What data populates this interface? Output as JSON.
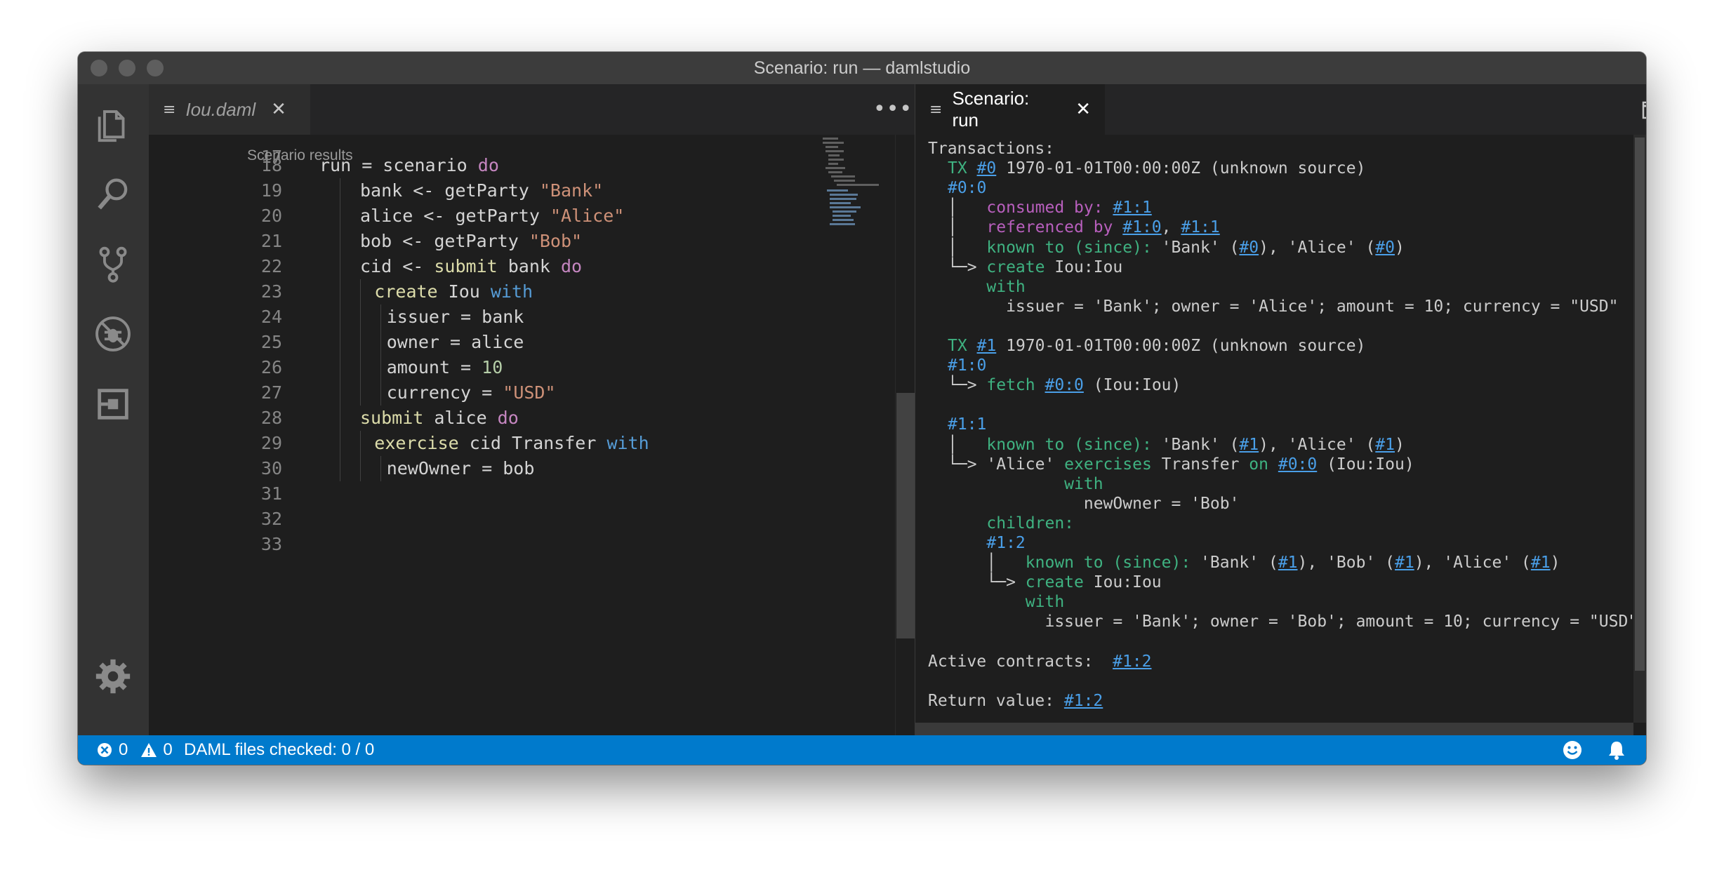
{
  "window": {
    "title": "Scenario: run — damlstudio"
  },
  "left_editor": {
    "tab_label": "Iou.daml",
    "codelens": "Scenario results",
    "partial_line_number": "17",
    "lines": [
      {
        "n": "18",
        "tokens": [
          [
            "run = scenario ",
            "p"
          ],
          [
            "do",
            "kw"
          ]
        ],
        "indent": 0
      },
      {
        "n": "19",
        "tokens": [
          [
            "bank <- getParty ",
            "p"
          ],
          [
            "\"Bank\"",
            "str"
          ]
        ],
        "indent": 1
      },
      {
        "n": "20",
        "tokens": [
          [
            "alice <- getParty ",
            "p"
          ],
          [
            "\"Alice\"",
            "str"
          ]
        ],
        "indent": 1
      },
      {
        "n": "21",
        "tokens": [
          [
            "bob <- getParty ",
            "p"
          ],
          [
            "\"Bob\"",
            "str"
          ]
        ],
        "indent": 1
      },
      {
        "n": "22",
        "tokens": [
          [
            "cid <- ",
            "p"
          ],
          [
            "submit",
            "fn"
          ],
          [
            " bank ",
            "p"
          ],
          [
            "do",
            "kw"
          ]
        ],
        "indent": 1
      },
      {
        "n": "23",
        "tokens": [
          [
            "create",
            "fn"
          ],
          [
            " Iou ",
            "p"
          ],
          [
            "with",
            "blue"
          ]
        ],
        "indent": 2
      },
      {
        "n": "24",
        "tokens": [
          [
            "issuer = bank",
            "p"
          ]
        ],
        "indent": 3
      },
      {
        "n": "25",
        "tokens": [
          [
            "owner = alice",
            "p"
          ]
        ],
        "indent": 3
      },
      {
        "n": "26",
        "tokens": [
          [
            "amount = ",
            "p"
          ],
          [
            "10",
            "num"
          ]
        ],
        "indent": 3
      },
      {
        "n": "27",
        "tokens": [
          [
            "currency = ",
            "p"
          ],
          [
            "\"USD\"",
            "str"
          ]
        ],
        "indent": 3
      },
      {
        "n": "28",
        "tokens": [
          [
            "submit",
            "fn"
          ],
          [
            " alice ",
            "p"
          ],
          [
            "do",
            "kw"
          ]
        ],
        "indent": 1
      },
      {
        "n": "29",
        "tokens": [
          [
            "exercise",
            "fn"
          ],
          [
            " cid Transfer ",
            "p"
          ],
          [
            "with",
            "blue"
          ]
        ],
        "indent": 2
      },
      {
        "n": "30",
        "tokens": [
          [
            "newOwner = bob",
            "p"
          ]
        ],
        "indent": 3
      },
      {
        "n": "31",
        "tokens": [],
        "indent": 0
      },
      {
        "n": "32",
        "tokens": [],
        "indent": 0
      },
      {
        "n": "33",
        "tokens": [],
        "indent": 0
      }
    ]
  },
  "right_editor": {
    "tab_label": "Scenario: run",
    "results": [
      {
        "x": 0,
        "tokens": [
          [
            "Transactions:",
            "p"
          ]
        ]
      },
      {
        "x": 2,
        "tokens": [
          [
            "TX ",
            "g"
          ],
          [
            "#0",
            "lnk"
          ],
          [
            " 1970-01-01T00:00:00Z (unknown source)",
            "p"
          ]
        ]
      },
      {
        "x": 2,
        "tokens": [
          [
            "#0:0",
            "b"
          ]
        ]
      },
      {
        "x": 2,
        "tokens": [
          [
            "│   ",
            "p"
          ],
          [
            "consumed by: ",
            "pp"
          ],
          [
            "#1:1",
            "lnk"
          ]
        ]
      },
      {
        "x": 2,
        "tokens": [
          [
            "│   ",
            "p"
          ],
          [
            "referenced by ",
            "pp"
          ],
          [
            "#1:0",
            "lnk"
          ],
          [
            ", ",
            "p"
          ],
          [
            "#1:1",
            "lnk"
          ]
        ]
      },
      {
        "x": 2,
        "tokens": [
          [
            "│   ",
            "p"
          ],
          [
            "known to (since): ",
            "g"
          ],
          [
            "'Bank' (",
            "p"
          ],
          [
            "#0",
            "lnk"
          ],
          [
            "), 'Alice' (",
            "p"
          ],
          [
            "#0",
            "lnk"
          ],
          [
            ")",
            "p"
          ]
        ]
      },
      {
        "x": 2,
        "tokens": [
          [
            "└─> ",
            "p"
          ],
          [
            "create",
            "g"
          ],
          [
            " Iou:Iou",
            "p"
          ]
        ]
      },
      {
        "x": 2,
        "tokens": [
          [
            "    ",
            "p"
          ],
          [
            "with",
            "g"
          ]
        ]
      },
      {
        "x": 2,
        "tokens": [
          [
            "      issuer = 'Bank'; owner = 'Alice'; amount = 10; currency = \"USD\"",
            "p"
          ]
        ]
      },
      {
        "x": 0,
        "tokens": []
      },
      {
        "x": 2,
        "tokens": [
          [
            "TX ",
            "g"
          ],
          [
            "#1",
            "lnk"
          ],
          [
            " 1970-01-01T00:00:00Z (unknown source)",
            "p"
          ]
        ]
      },
      {
        "x": 2,
        "tokens": [
          [
            "#1:0",
            "b"
          ]
        ]
      },
      {
        "x": 2,
        "tokens": [
          [
            "└─> ",
            "p"
          ],
          [
            "fetch",
            "g"
          ],
          [
            " ",
            "p"
          ],
          [
            "#0:0",
            "lnk"
          ],
          [
            " (Iou:Iou)",
            "p"
          ]
        ]
      },
      {
        "x": 0,
        "tokens": []
      },
      {
        "x": 2,
        "tokens": [
          [
            "#1:1",
            "b"
          ]
        ]
      },
      {
        "x": 2,
        "tokens": [
          [
            "│   ",
            "p"
          ],
          [
            "known to (since): ",
            "g"
          ],
          [
            "'Bank' (",
            "p"
          ],
          [
            "#1",
            "lnk"
          ],
          [
            "), 'Alice' (",
            "p"
          ],
          [
            "#1",
            "lnk"
          ],
          [
            ")",
            "p"
          ]
        ]
      },
      {
        "x": 2,
        "tokens": [
          [
            "└─> ",
            "p"
          ],
          [
            "'Alice' ",
            "p"
          ],
          [
            "exercises",
            "g"
          ],
          [
            " Transfer ",
            "p"
          ],
          [
            "on",
            "g"
          ],
          [
            " ",
            "p"
          ],
          [
            "#0:0",
            "lnk"
          ],
          [
            " (Iou:Iou)",
            "p"
          ]
        ]
      },
      {
        "x": 2,
        "tokens": [
          [
            "            ",
            "p"
          ],
          [
            "with",
            "g"
          ]
        ]
      },
      {
        "x": 2,
        "tokens": [
          [
            "              newOwner = 'Bob'",
            "p"
          ]
        ]
      },
      {
        "x": 2,
        "tokens": [
          [
            "    ",
            "p"
          ],
          [
            "children:",
            "g"
          ]
        ]
      },
      {
        "x": 2,
        "tokens": [
          [
            "    ",
            "p"
          ],
          [
            "#1:2",
            "b"
          ]
        ]
      },
      {
        "x": 2,
        "tokens": [
          [
            "    │   ",
            "p"
          ],
          [
            "known to (since): ",
            "g"
          ],
          [
            "'Bank' (",
            "p"
          ],
          [
            "#1",
            "lnk"
          ],
          [
            "), 'Bob' (",
            "p"
          ],
          [
            "#1",
            "lnk"
          ],
          [
            "), 'Alice' (",
            "p"
          ],
          [
            "#1",
            "lnk"
          ],
          [
            ")",
            "p"
          ]
        ]
      },
      {
        "x": 2,
        "tokens": [
          [
            "    └─> ",
            "p"
          ],
          [
            "create",
            "g"
          ],
          [
            " Iou:Iou",
            "p"
          ]
        ]
      },
      {
        "x": 2,
        "tokens": [
          [
            "        ",
            "p"
          ],
          [
            "with",
            "g"
          ]
        ]
      },
      {
        "x": 2,
        "tokens": [
          [
            "          issuer = 'Bank'; owner = 'Bob'; amount = 10; currency = \"USD\"",
            "p"
          ]
        ]
      },
      {
        "x": 0,
        "tokens": []
      },
      {
        "x": 0,
        "tokens": [
          [
            "Active contracts:  ",
            "p"
          ],
          [
            "#1:2",
            "lnk"
          ]
        ]
      },
      {
        "x": 0,
        "tokens": []
      },
      {
        "x": 0,
        "tokens": [
          [
            "Return value: ",
            "p"
          ],
          [
            "#1:2",
            "lnk"
          ]
        ]
      }
    ]
  },
  "statusbar": {
    "errors": "0",
    "warnings": "0",
    "message": "DAML files checked: 0 / 0"
  },
  "icons": {
    "activity": [
      "explorer-icon",
      "search-icon",
      "source-control-icon",
      "debug-icon",
      "extensions-icon",
      "settings-gear-icon"
    ]
  }
}
